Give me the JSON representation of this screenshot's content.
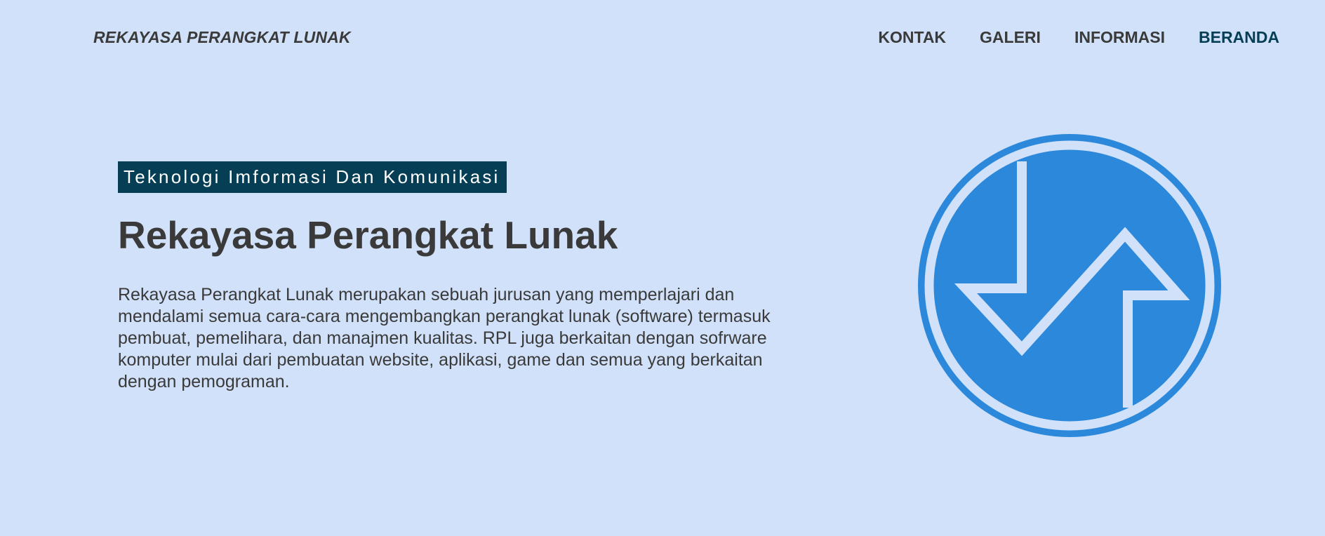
{
  "header": {
    "brand": "REKAYASA PERANGKAT LUNAK",
    "nav": [
      {
        "label": "KONTAK",
        "active": false
      },
      {
        "label": "GALERI",
        "active": false
      },
      {
        "label": "INFORMASI",
        "active": false
      },
      {
        "label": "BERANDA",
        "active": true
      }
    ]
  },
  "hero": {
    "tag": "Teknologi Imformasi Dan Komunikasi",
    "title": "Rekayasa Perangkat Lunak",
    "description": "Rekayasa Perangkat Lunak merupakan sebuah jurusan yang memperlajari dan mendalami semua cara-cara mengembangkan perangkat lunak (software) termasuk pembuat, pemelihara, dan manajmen kualitas. RPL juga berkaitan dengan sofrware komputer mulai dari pembuatan website, aplikasi, game dan semua yang berkaitan dengan pemograman."
  },
  "logo": {
    "icon": "rpl-logo-icon",
    "color": "#2b88db",
    "inner_color": "#d0e1f9"
  },
  "colors": {
    "background": "#d0e1f9",
    "accent": "#063f55",
    "text": "#3a3a3a"
  }
}
